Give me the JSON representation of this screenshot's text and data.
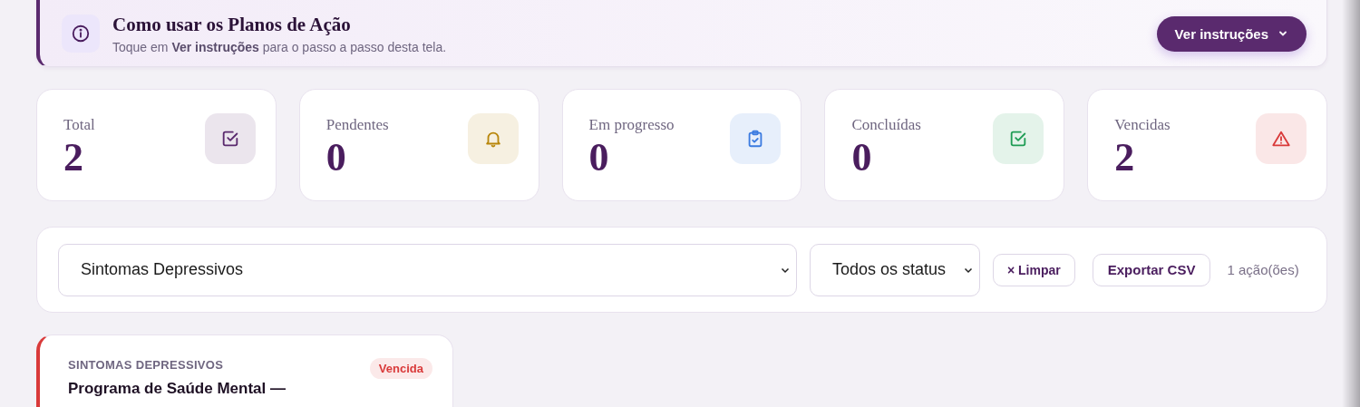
{
  "banner": {
    "title": "Como usar os Planos de Ação",
    "text": "Toque em **Ver instruções** para o passo a passo desta tela.",
    "button": "Ver instruções"
  },
  "stats": [
    {
      "label": "Total",
      "value": "2",
      "kind": "checkbox",
      "color": "#5a2a6e"
    },
    {
      "label": "Pendentes",
      "value": "0",
      "kind": "bell",
      "color": "#b8860b"
    },
    {
      "label": "Em progresso",
      "value": "0",
      "kind": "clipboard",
      "color": "#3b7be0"
    },
    {
      "label": "Concluídas",
      "value": "0",
      "kind": "checkbox",
      "color": "#1f9d55"
    },
    {
      "label": "Vencidas",
      "value": "2",
      "kind": "warning",
      "color": "#d93a3a"
    }
  ],
  "filters": {
    "topic": "Sintomas Depressivos",
    "status": "Todos os status",
    "clear_button": "× Limpar",
    "export_button": "Exportar CSV",
    "count": "1 ação(ões)"
  },
  "actions": [
    {
      "category": "SINTOMAS DEPRESSIVOS",
      "title": "Programa de Saúde Mental —",
      "status": "Vencida",
      "kind": "overdue"
    }
  ]
}
